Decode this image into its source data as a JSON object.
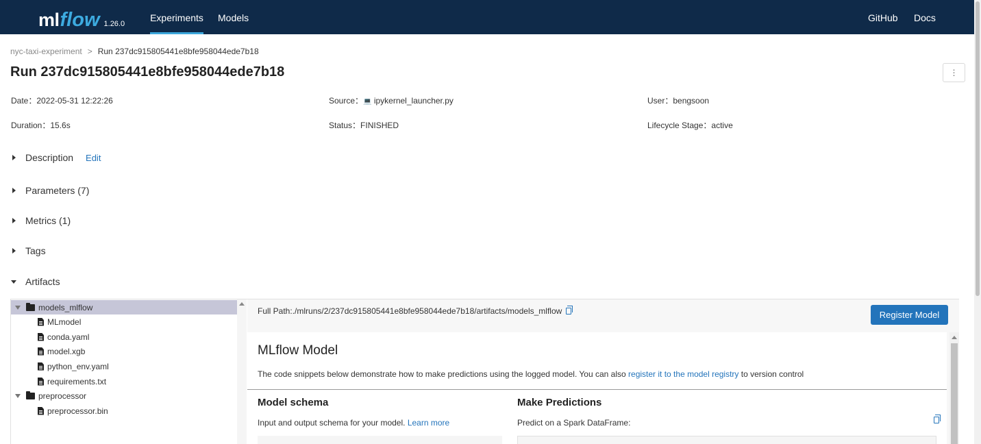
{
  "app": {
    "logo_ml": "ml",
    "logo_flow": "flow",
    "version": "1.26.0"
  },
  "nav": {
    "experiments": "Experiments",
    "models": "Models",
    "github": "GitHub",
    "docs": "Docs"
  },
  "breadcrumb": {
    "experiment": "nyc-taxi-experiment",
    "separator": ">",
    "current": "Run 237dc915805441e8bfe958044ede7b18"
  },
  "run": {
    "title": "Run 237dc915805441e8bfe958044ede7b18",
    "menu_icon": "⋮",
    "date_label": "Date：",
    "date_value": "2022-05-31 12:22:26",
    "source_label": "Source：",
    "source_icon": "💻",
    "source_value": "ipykernel_launcher.py",
    "user_label": "User：",
    "user_value": "bengsoon",
    "duration_label": "Duration：",
    "duration_value": "15.6s",
    "status_label": "Status：",
    "status_value": "FINISHED",
    "lifecycle_label": "Lifecycle Stage：",
    "lifecycle_value": "active"
  },
  "sections": {
    "description": "Description",
    "edit": "Edit",
    "parameters": "Parameters (7)",
    "metrics": "Metrics (1)",
    "tags": "Tags",
    "artifacts": "Artifacts"
  },
  "tree": {
    "items": [
      {
        "label": "models_mlflow",
        "type": "folder"
      },
      {
        "label": "MLmodel",
        "type": "file"
      },
      {
        "label": "conda.yaml",
        "type": "file"
      },
      {
        "label": "model.xgb",
        "type": "file"
      },
      {
        "label": "python_env.yaml",
        "type": "file"
      },
      {
        "label": "requirements.txt",
        "type": "file"
      },
      {
        "label": "preprocessor",
        "type": "folder"
      },
      {
        "label": "preprocessor.bin",
        "type": "file"
      }
    ]
  },
  "artifact_detail": {
    "full_path": "Full Path:./mlruns/2/237dc915805441e8bfe958044ede7b18/artifacts/models_mlflow",
    "register_button": "Register Model",
    "model_title": "MLflow Model",
    "desc_prefix": "The code snippets below demonstrate how to make predictions using the logged model. You can also",
    "desc_link": "register it to the model registry",
    "desc_suffix": "to version control",
    "schema_title": "Model schema",
    "schema_text": "Input and output schema for your model.",
    "schema_link": "Learn more",
    "predict_title": "Make Predictions",
    "predict_text": "Predict on a Spark DataFrame:"
  }
}
